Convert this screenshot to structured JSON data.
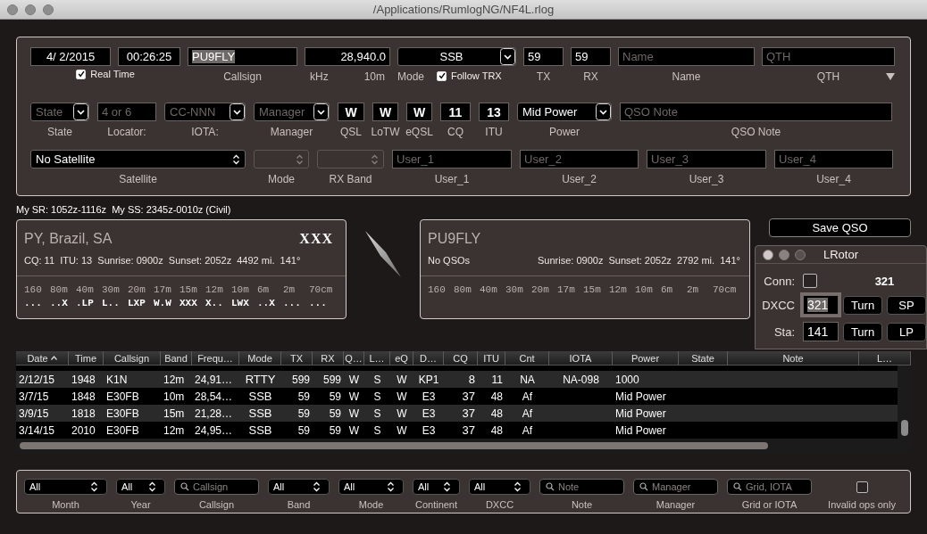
{
  "window": {
    "title": "/Applications/RumlogNG/NF4L.rlog"
  },
  "entry": {
    "date": "4/ 2/2015",
    "time": "00:26:25",
    "real_time": {
      "label": "Real Time",
      "checked": true
    },
    "callsign": {
      "value": "PU9FLY",
      "text_selected": true,
      "label": "Callsign"
    },
    "frequency": {
      "value": "28,940.0",
      "unit": "kHz",
      "band": "10m"
    },
    "mode": {
      "value": "SSB",
      "label": "Mode"
    },
    "follow_trx": {
      "label": "Follow TRX",
      "checked": true
    },
    "tx": {
      "value": "59",
      "label": "TX"
    },
    "rx": {
      "value": "59",
      "label": "RX"
    },
    "name": {
      "placeholder": "Name",
      "label": "Name"
    },
    "qth": {
      "placeholder": "QTH",
      "label": "QTH"
    },
    "row_2": [
      {
        "kind": "popup",
        "placeholder": "State",
        "label": "State"
      },
      {
        "kind": "text",
        "placeholder": "4 or 6",
        "label": "Locator:"
      },
      {
        "kind": "popup",
        "placeholder": "CC-NNN",
        "label": "IOTA:"
      },
      {
        "kind": "popup",
        "placeholder": "Manager",
        "label": "Manager"
      },
      {
        "kind": "short",
        "value": "W",
        "label": "QSL"
      },
      {
        "kind": "short",
        "value": "W",
        "label": "LoTW"
      },
      {
        "kind": "short",
        "value": "W",
        "label": "eQSL"
      },
      {
        "kind": "short",
        "value": "11",
        "label": "CQ"
      },
      {
        "kind": "short",
        "value": "13",
        "label": "ITU"
      },
      {
        "kind": "popup",
        "value": "Mid Power",
        "label": "Power"
      },
      {
        "kind": "text",
        "placeholder": "QSO Note",
        "label": "QSO Note"
      }
    ],
    "row_3": [
      {
        "kind": "stepper",
        "value": "No Satellite",
        "label": "Satellite",
        "disabled": false
      },
      {
        "kind": "stepper",
        "label": "Mode",
        "disabled": true
      },
      {
        "kind": "stepper",
        "label": "RX Band",
        "disabled": true
      },
      {
        "kind": "text",
        "placeholder": "User_1",
        "label": "User_1",
        "disabled": false
      },
      {
        "kind": "text",
        "placeholder": "User_2",
        "label": "User_2",
        "disabled": false
      },
      {
        "kind": "text",
        "placeholder": "User_3",
        "label": "User_3",
        "disabled": false
      },
      {
        "kind": "text",
        "placeholder": "User_4",
        "label": "User_4",
        "disabled": false
      }
    ]
  },
  "sun_times": "My SR: 1052z-1116z  My SS: 2345z-0010z (Civil)",
  "dx_card": {
    "title": "PY, Brazil, SA",
    "status": "XXX",
    "info": "CQ: 11  ITU: 13  Sunrise: 0900z  Sunset: 2052z  4492 mi.  141°",
    "bands": [
      "160",
      "80m",
      "40m",
      "30m",
      "20m",
      "17m",
      "15m",
      "12m",
      "10m",
      "6m",
      "2m",
      "70cm"
    ],
    "band_status": [
      "...",
      "..X",
      ".LP",
      "L..",
      "LXP",
      "W.W",
      "XXX",
      "X..",
      "LWX",
      "..X",
      "...",
      "..."
    ]
  },
  "call_card": {
    "title": "PU9FLY",
    "qsos": "No QSOs",
    "info": "Sunrise: 0900z  Sunset: 2052z  2792 mi.  141°",
    "bands": [
      "160",
      "80m",
      "40m",
      "30m",
      "20m",
      "17m",
      "15m",
      "12m",
      "10m",
      "6m",
      "2m",
      "70cm"
    ]
  },
  "save_button": "Save QSO",
  "rotor": {
    "title": "LRotor",
    "conn_label": "Conn:",
    "connected": false,
    "heading": "321",
    "rows": [
      {
        "label": "DXCC",
        "value": "321",
        "text_selected": true,
        "turn": "Turn",
        "preset": "SP"
      },
      {
        "label": "Sta:",
        "value": "141",
        "text_selected": false,
        "turn": "Turn",
        "preset": "LP"
      }
    ]
  },
  "log_table": {
    "columns": [
      {
        "label": "Date",
        "sorted": true
      },
      {
        "label": "Time",
        "sorted": false
      },
      {
        "label": "Callsign",
        "sorted": false
      },
      {
        "label": "Band",
        "sorted": false
      },
      {
        "label": "Frequ…",
        "sorted": false
      },
      {
        "label": "Mode",
        "sorted": false
      },
      {
        "label": "TX",
        "sorted": false
      },
      {
        "label": "RX",
        "sorted": false
      },
      {
        "label": "Q…",
        "sorted": false
      },
      {
        "label": "L…",
        "sorted": false
      },
      {
        "label": "eQ",
        "sorted": false
      },
      {
        "label": "D…",
        "sorted": false
      },
      {
        "label": "CQ",
        "sorted": false
      },
      {
        "label": "ITU",
        "sorted": false
      },
      {
        "label": "Cnt",
        "sorted": false
      },
      {
        "label": "IOTA",
        "sorted": false
      },
      {
        "label": "Power",
        "sorted": false
      },
      {
        "label": "State",
        "sorted": false
      },
      {
        "label": "Note",
        "sorted": false
      },
      {
        "label": "L…",
        "sorted": false
      }
    ],
    "rows": [
      [
        "2/12/15",
        "1948",
        "K1N",
        "12m",
        "24,91…",
        "RTTY",
        "599",
        "599",
        "W",
        "S",
        "W",
        "KP1",
        "8",
        "11",
        "NA",
        "NA-098",
        "1000"
      ],
      [
        "3/7/15",
        "1848",
        "E30FB",
        "10m",
        "28,54…",
        "SSB",
        "59",
        "59",
        "W",
        "S",
        "W",
        "E3",
        "37",
        "48",
        "Af",
        null,
        "Mid Power"
      ],
      [
        "3/9/15",
        "1818",
        "E30FB",
        "15m",
        "21,28…",
        "SSB",
        "59",
        "59",
        "W",
        "S",
        "W",
        "E3",
        "37",
        "48",
        "Af",
        null,
        "Mid Power"
      ],
      [
        "3/14/15",
        "2010",
        "E30FB",
        "12m",
        "24,95…",
        "SSB",
        "59",
        "59",
        "W",
        "S",
        "W",
        "E3",
        "37",
        "48",
        "Af",
        null,
        "Mid Power"
      ]
    ]
  },
  "filters": [
    {
      "kind": "popup",
      "value": "All",
      "label": "Month"
    },
    {
      "kind": "popup",
      "value": "All",
      "label": "Year"
    },
    {
      "kind": "search",
      "placeholder": "Callsign",
      "label": "Callsign"
    },
    {
      "kind": "popup",
      "value": "All",
      "label": "Band"
    },
    {
      "kind": "popup",
      "value": "All",
      "label": "Mode"
    },
    {
      "kind": "popup",
      "value": "All",
      "label": "Continent"
    },
    {
      "kind": "popup",
      "value": "All",
      "label": "DXCC"
    },
    {
      "kind": "search",
      "placeholder": "Note",
      "label": "Note"
    },
    {
      "kind": "search",
      "placeholder": "Manager",
      "label": "Manager"
    },
    {
      "kind": "search",
      "placeholder": "Grid, IOTA",
      "label": "Grid or IOTA"
    },
    {
      "kind": "checkbox",
      "checked": false,
      "label": "Invalid ops only"
    }
  ]
}
